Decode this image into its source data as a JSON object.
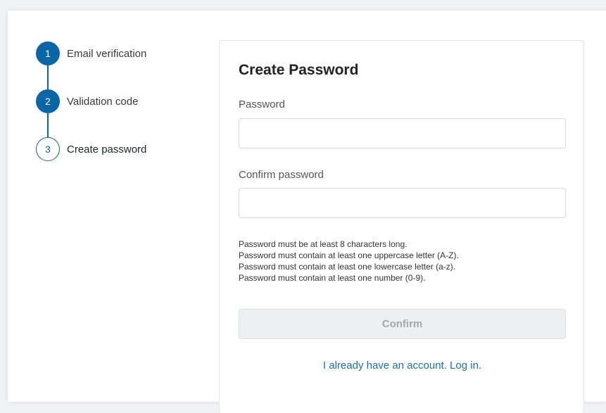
{
  "stepper": {
    "steps": [
      {
        "number": "1",
        "label": "Email verification",
        "state": "complete"
      },
      {
        "number": "2",
        "label": "Validation code",
        "state": "complete"
      },
      {
        "number": "3",
        "label": "Create password",
        "state": "current"
      }
    ]
  },
  "form": {
    "title": "Create Password",
    "password_label": "Password",
    "password_value": "",
    "confirm_label": "Confirm password",
    "confirm_value": "",
    "rules": [
      "Password must be at least 8 characters long.",
      "Password must contain at least one uppercase letter (A-Z).",
      "Password must contain at least one lowercase letter (a-z).",
      "Password must contain at least one number (0-9)."
    ],
    "confirm_button": "Confirm",
    "login_link": "I already have an account. Log in."
  },
  "colors": {
    "accent": "#0a66a8",
    "link": "#1b6fb3",
    "disabled_text": "#a3a7ab"
  }
}
